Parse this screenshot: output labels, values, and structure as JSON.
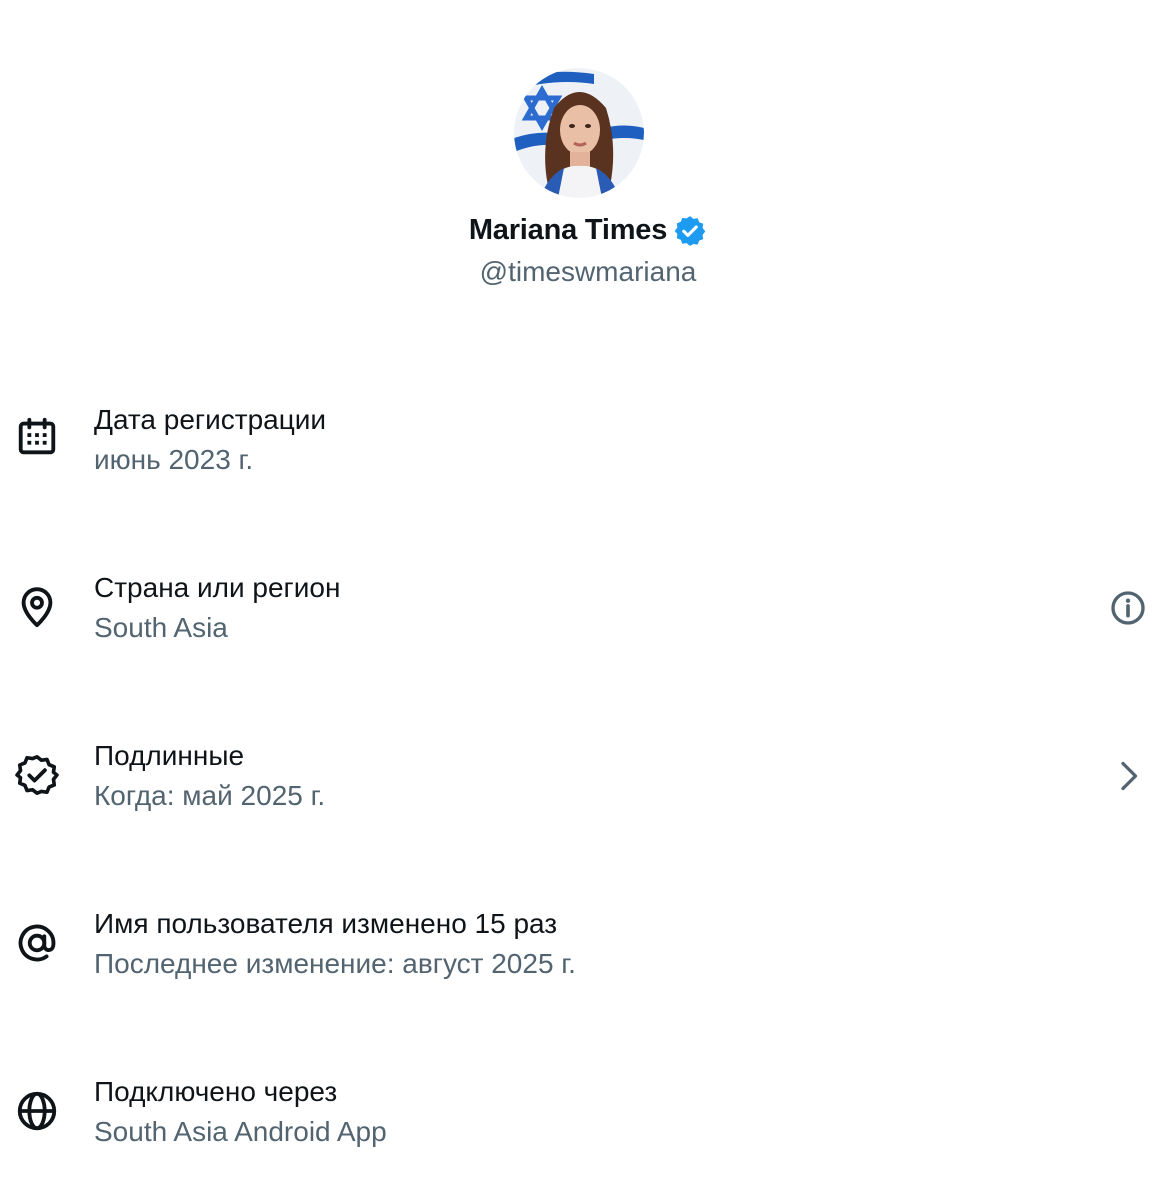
{
  "profile": {
    "display_name": "Mariana Times",
    "handle": "@timeswmariana",
    "verified": true,
    "avatar_icon": "avatar-photo",
    "verified_color": "#1d9bf0"
  },
  "info": {
    "joined": {
      "icon": "calendar-icon",
      "title": "Дата регистрации",
      "value": "июнь 2023 г."
    },
    "country": {
      "icon": "location-pin-icon",
      "title": "Страна или регион",
      "value": "South Asia",
      "action_icon": "info-icon"
    },
    "authentic": {
      "icon": "verified-badge-outline-icon",
      "title": "Подлинные",
      "value": "Когда: май 2025 г.",
      "action_icon": "chevron-right-icon"
    },
    "username_changes": {
      "icon": "at-sign-icon",
      "title": "Имя пользователя изменено 15 раз",
      "value": "Последнее изменение: август 2025 г."
    },
    "connected_via": {
      "icon": "globe-icon",
      "title": "Подключено через",
      "value": "South Asia Android App"
    }
  },
  "colors": {
    "primary_text": "#0f1419",
    "secondary_text": "#536471",
    "accent": "#1d9bf0"
  }
}
